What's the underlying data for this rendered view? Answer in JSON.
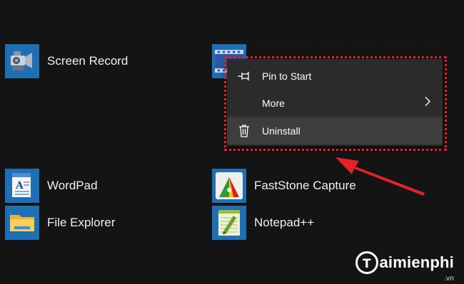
{
  "start_tiles": [
    {
      "label": "Screen Record",
      "icon": "screen-record-icon"
    },
    {
      "label": "",
      "icon": "video-editor-icon"
    },
    {
      "label": "WordPad",
      "icon": "wordpad-icon"
    },
    {
      "label": "FastStone Capture",
      "icon": "faststone-capture-icon"
    },
    {
      "label": "File Explorer",
      "icon": "folder-icon"
    },
    {
      "label": "Notepad++",
      "icon": "notepad-plus-plus-icon"
    }
  ],
  "context_menu": {
    "items": [
      {
        "label": "Pin to Start",
        "icon": "pin-icon"
      },
      {
        "label": "More",
        "icon": "chevron-right-icon"
      },
      {
        "label": "Uninstall",
        "icon": "trash-icon"
      }
    ]
  },
  "annotation": {
    "frame_color": "#e3222a",
    "arrow_color": "#e3222a"
  },
  "watermark": {
    "brand": "aimienphi",
    "suffix": ".vn"
  }
}
